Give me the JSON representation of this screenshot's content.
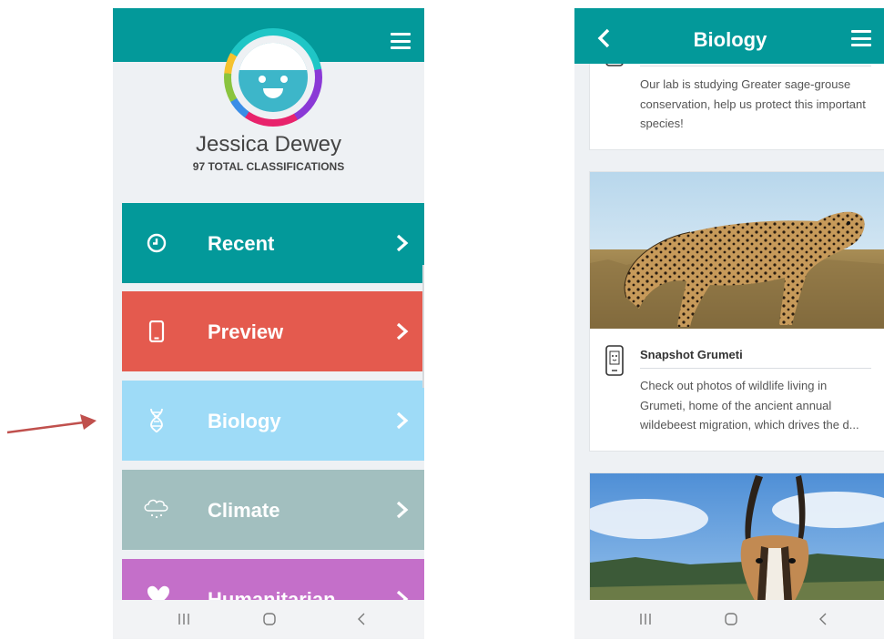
{
  "left_screen": {
    "profile": {
      "name": "Jessica Dewey",
      "subtitle": "97 TOTAL CLASSIFICATIONS"
    },
    "menu_icon": "hamburger-icon",
    "categories": [
      {
        "label": "Recent",
        "icon": "clock-icon",
        "color": "#03999a"
      },
      {
        "label": "Preview",
        "icon": "smartphone-icon",
        "color": "#e45a4e"
      },
      {
        "label": "Biology",
        "icon": "dna-icon",
        "color": "#9edbf7"
      },
      {
        "label": "Climate",
        "icon": "rain-cloud-icon",
        "color": "#a2bfbf"
      },
      {
        "label": "Humanitarian",
        "icon": "heart-hand-icon",
        "color": "#c46fc9"
      }
    ]
  },
  "right_screen": {
    "title": "Biology",
    "back_icon": "chevron-left-icon",
    "menu_icon": "hamburger-icon",
    "projects": [
      {
        "name": "",
        "description": "Our lab is studying Greater sage-grouse conservation, help us protect this important species!"
      },
      {
        "name": "Snapshot Grumeti",
        "description_lines": [
          "Check out photos of wildlife living in",
          "Grumeti, home of the ancient annual",
          "wildebeest migration, which drives the d..."
        ]
      }
    ]
  },
  "system_nav": [
    "recent-apps-icon",
    "home-icon",
    "back-icon"
  ],
  "colors": {
    "teal": "#03999a",
    "background": "#eef1f4",
    "annotation_arrow": "#c0504d"
  }
}
